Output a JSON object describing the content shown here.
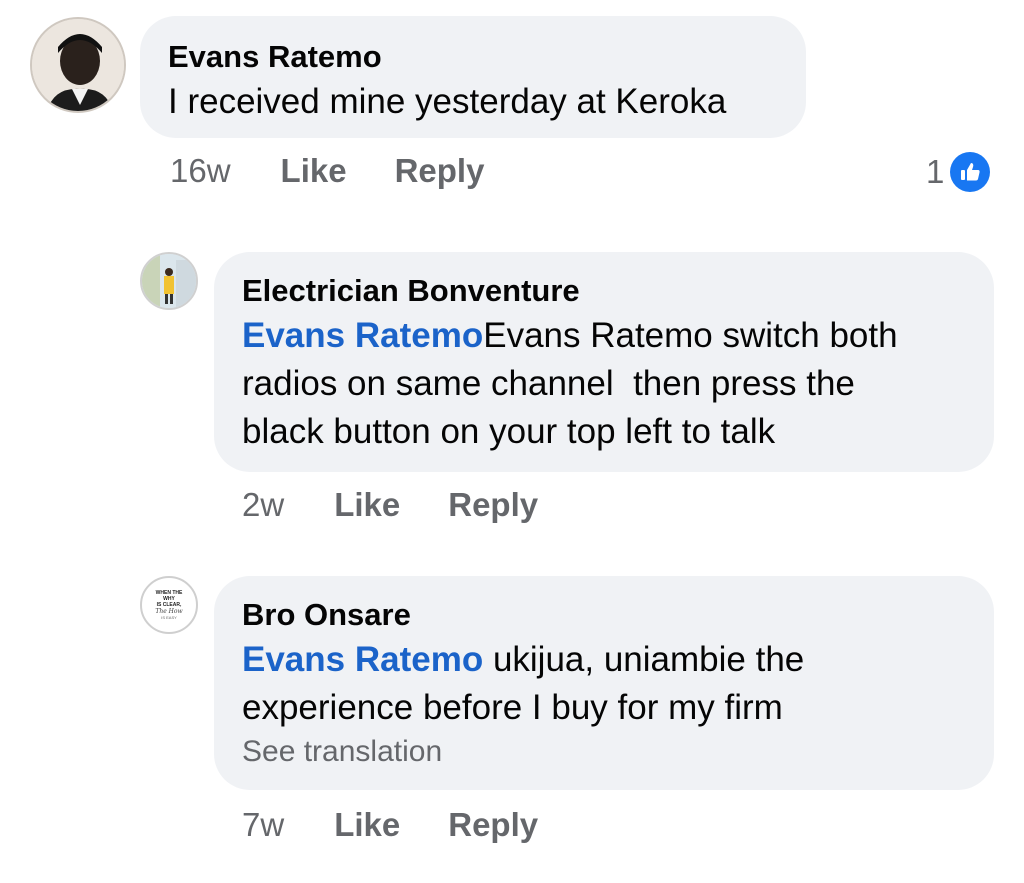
{
  "comments": [
    {
      "author": "Evans Ratemo",
      "text": "I received mine yesterday at Keroka",
      "time": "16w",
      "like_label": "Like",
      "reply_label": "Reply",
      "reaction_count": "1",
      "reaction_icon": "like-icon"
    },
    {
      "author": "Electrician Bonventure",
      "mention": "Evans Ratemo",
      "text_lines": [
        "Evans Ratemo switch both",
        "radios on same channel  then press the",
        "black button on your top left to talk"
      ],
      "time": "2w",
      "like_label": "Like",
      "reply_label": "Reply"
    },
    {
      "author": "Bro Onsare",
      "mention": "Evans Ratemo",
      "text_lines": [
        " ukijua, uniambie the",
        "experience before I buy for my firm"
      ],
      "see_translation": "See translation",
      "avatar_text": [
        "WHEN THE",
        "WHY",
        "IS CLEAR,",
        "The How",
        "IS EASY"
      ],
      "time": "7w",
      "like_label": "Like",
      "reply_label": "Reply"
    }
  ],
  "colors": {
    "bubble": "#f0f2f5",
    "mention": "#1b63c9",
    "meta": "#65676b",
    "like_badge": "#1877f2"
  }
}
